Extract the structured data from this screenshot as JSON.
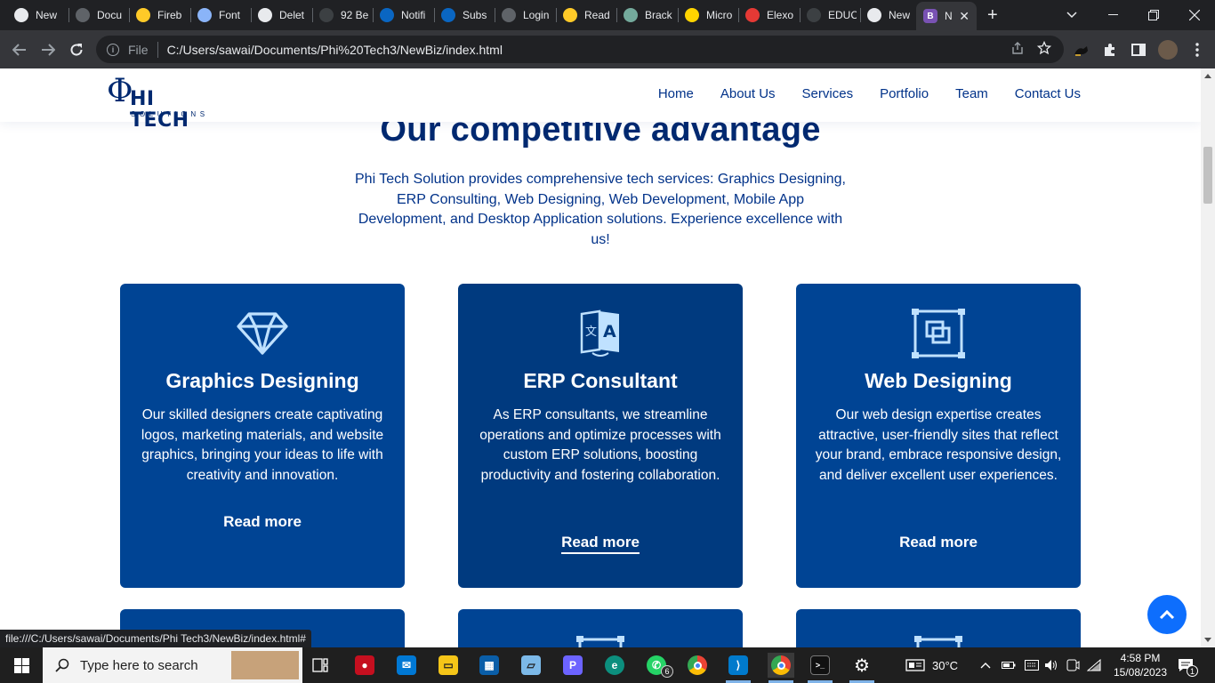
{
  "browser": {
    "tabs": [
      {
        "label": "New",
        "icon": "chrome-icon",
        "color": "#e8eaed"
      },
      {
        "label": "Docu",
        "icon": "globe-icon",
        "color": "#5f6368"
      },
      {
        "label": "Fireb",
        "icon": "firebase-icon",
        "color": "#ffca28"
      },
      {
        "label": "Font",
        "icon": "flag-icon",
        "color": "#8ab4f8"
      },
      {
        "label": "Delet",
        "icon": "codepen-icon",
        "color": "#e8eaed"
      },
      {
        "label": "92 Be",
        "icon": "cursor-icon",
        "color": "#3c4043"
      },
      {
        "label": "Notifi",
        "icon": "linkedin-icon",
        "color": "#0a66c2"
      },
      {
        "label": "Subs",
        "icon": "linkedin-icon",
        "color": "#0a66c2"
      },
      {
        "label": "Login",
        "icon": "globe-icon",
        "color": "#5f6368"
      },
      {
        "label": "Read",
        "icon": "firebase-icon",
        "color": "#ffca28"
      },
      {
        "label": "Brack",
        "icon": "chatgpt-icon",
        "color": "#74aa9c"
      },
      {
        "label": "Micro",
        "icon": "chevron-icon",
        "color": "#ffd400"
      },
      {
        "label": "Elexo",
        "icon": "elexo-icon",
        "color": "#e53935"
      },
      {
        "label": "EDUC",
        "icon": "circle-icon",
        "color": "#3c4043"
      },
      {
        "label": "New",
        "icon": "chrome-icon",
        "color": "#e8eaed"
      }
    ],
    "active_tab": {
      "label": "N",
      "icon": "bootstrap-icon",
      "icon_letter": "B",
      "color": "#7952b3"
    },
    "address": {
      "scheme": "File",
      "url": "C:/Users/sawai/Documents/Phi%20Tech3/NewBiz/index.html"
    },
    "status_url": "file:///C:/Users/sawai/Documents/Phi Tech3/NewBiz/index.html#"
  },
  "site": {
    "logo": {
      "phi": "Φ",
      "brand": "HI TECH",
      "tagline": "SOLUTIONS"
    },
    "nav": [
      "Home",
      "About Us",
      "Services",
      "Portfolio",
      "Team",
      "Contact Us"
    ],
    "section_title": "Our competitive advantage",
    "section_desc": "Phi Tech Solution provides comprehensive tech services: Graphics Designing, ERP Consulting, Web Designing, Web Development, Mobile App Development, and Desktop Application solutions. Experience excellence with us!",
    "cards": [
      {
        "title": "Graphics Designing",
        "text": "Our skilled designers create captivating logos, marketing materials, and website graphics, bringing your ideas to life with creativity and innovation.",
        "link": "Read more",
        "icon": "diamond-icon"
      },
      {
        "title": "ERP Consultant",
        "text": "As ERP consultants, we streamline operations and optimize processes with custom ERP solutions, boosting productivity and fostering collaboration.",
        "link": "Read more",
        "icon": "translate-icon"
      },
      {
        "title": "Web Designing",
        "text": "Our web design expertise creates attractive, user-friendly sites that reflect your brand, embrace responsive design, and deliver excellent user experiences.",
        "link": "Read more",
        "icon": "bounding-box-icon"
      }
    ],
    "colors": {
      "primary": "#012970",
      "accent": "#013289",
      "card": "#004494",
      "card_hover": "#003a7f",
      "back_to_top": "#0d6efd"
    }
  },
  "taskbar": {
    "search_placeholder": "Type here to search",
    "whatsapp_badge": "6",
    "weather": "30°C",
    "time": "4:58 PM",
    "date": "15/08/2023",
    "notifications": "1"
  }
}
